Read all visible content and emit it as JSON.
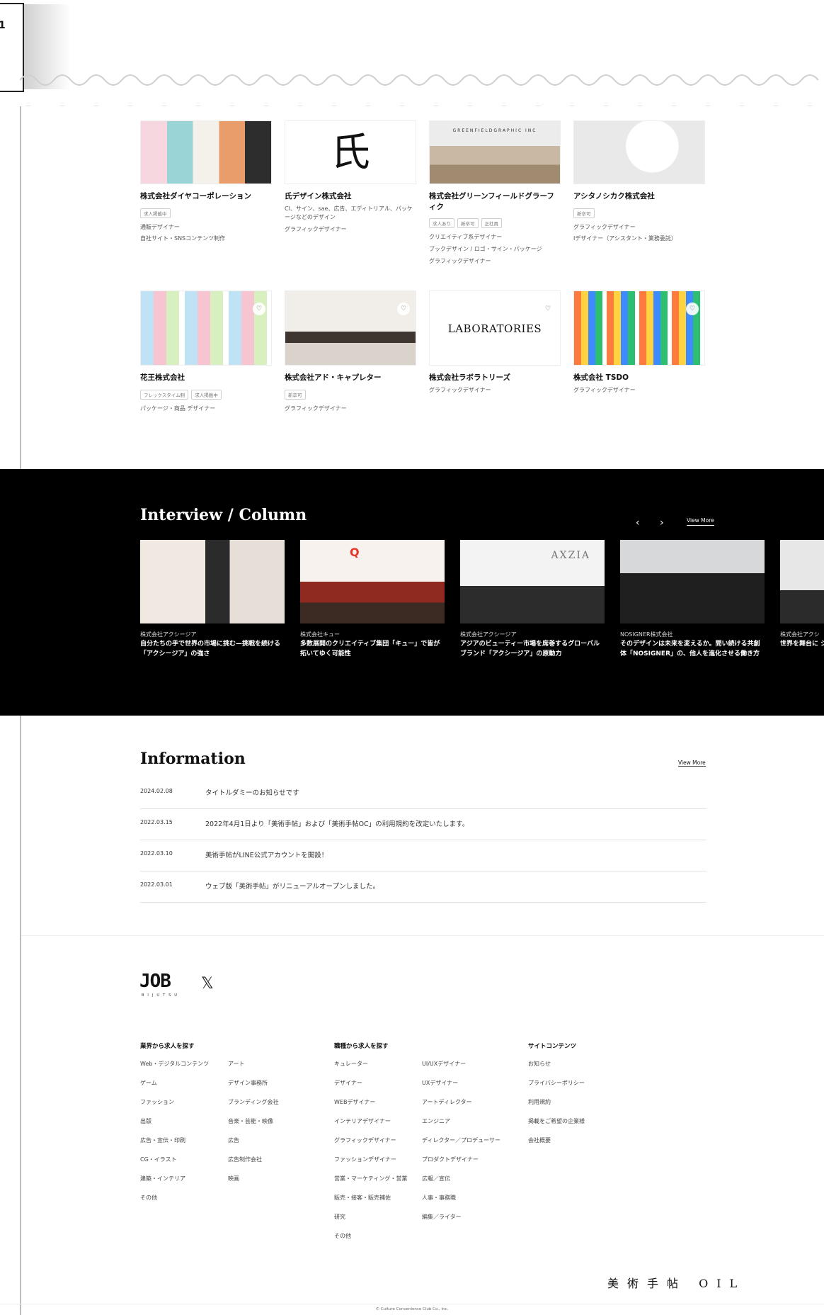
{
  "corner_label": "1",
  "companies": [
    {
      "name": "株式会社ダイヤコーポレーション",
      "tags": [
        "求人掲載中"
      ],
      "desc": [
        "通販デザイナー",
        "自社サイト・SNSコンテンツ制作"
      ],
      "thumb": "collage-people"
    },
    {
      "name": "氏デザイン株式会社",
      "tags": [],
      "desc": [
        "CI、サイン、sae、広告、エディトリアル、パッケージなどのデザイン",
        "グラフィックデザイナー"
      ],
      "thumb": "kanji",
      "kanji": "氏"
    },
    {
      "name": "株式会社グリーンフィールドグラーフィク",
      "tags": [
        "求人あり",
        "新卒可",
        "正社員"
      ],
      "desc": [
        "クリエイティブ系デザイナー",
        "ブックデザイン / ロゴ・サイン・パッケージ",
        "グラフィックデザイナー"
      ],
      "thumb": "office",
      "sign": "GREENFIELDGRAPHIC INC"
    },
    {
      "name": "アシタノシカク株式会社",
      "tags": [
        "新卒可"
      ],
      "desc": [
        "グラフィックデザイナー",
        "Iデザイナー（アシスタント・業務委託）"
      ],
      "thumb": "white"
    },
    {
      "name": "花王株式会社",
      "tags": [
        "フレックスタイム制",
        "求人掲載中"
      ],
      "desc": [
        "パッケージ・商品 デザイナー"
      ],
      "thumb": "products"
    },
    {
      "name": "株式会社アド・キャプレター",
      "tags": [
        "新卒可"
      ],
      "desc": [
        "グラフィックデザイナー"
      ],
      "thumb": "room"
    },
    {
      "name": "株式会社ラボラトリーズ",
      "tags": [],
      "desc": [
        "グラフィックデザイナー"
      ],
      "thumb": "laboratories",
      "logo": "LABORATORIES"
    },
    {
      "name": "株式会社 TSDO",
      "tags": [],
      "desc": [
        "グラフィックデザイナー"
      ],
      "thumb": "colorful"
    }
  ],
  "interview": {
    "title": "Interview / Column",
    "prev": "‹",
    "next": "›",
    "more": "View More",
    "cards": [
      {
        "company": "株式会社アクシージア",
        "text": "自分たちの手で世界の市場に挑む—挑戦を続ける「アクシージア」の強さ"
      },
      {
        "company": "株式会社キュー",
        "text": "多数展開のクリエイティブ集団「キュー」で皆が拓いてゆく可能性"
      },
      {
        "company": "株式会社アクシージア",
        "text": "アジアのビューティー市場を席巻するグローバルブランド「アクシージア」の原動力"
      },
      {
        "company": "NOSIGNER株式会社",
        "text": "そのデザインは未来を変えるか。問い続ける共創体「NOSIGNER」の、他人を進化させる働き方"
      },
      {
        "company": "株式会社アクシ",
        "text": "世界を舞台に シージアの強"
      }
    ],
    "axzia_sign": "AXZIA",
    "q_sign": "Q"
  },
  "information": {
    "title": "Information",
    "more": "View More",
    "items": [
      {
        "date": "2024.02.08",
        "text": "タイトルダミーのお知らせです"
      },
      {
        "date": "2022.03.15",
        "text": "2022年4月1日より「美術手帖」および「美術手帖OC」の利用規約を改定いたします。"
      },
      {
        "date": "2022.03.10",
        "text": "美術手帖がLINE公式アカウントを開設！"
      },
      {
        "date": "2022.03.01",
        "text": "ウェブ版「美術手帖」がリニューアルオープンしました。"
      }
    ]
  },
  "footer": {
    "logo": "JOB",
    "logo_sub": "BIJUTSU",
    "x_logo": "𝕏",
    "columns": [
      {
        "heading": "業界から求人を探す",
        "links": [
          [
            "Web・デジタルコンテンツ",
            "ゲーム",
            "ファッション",
            "出版",
            "広告・宣伝・印刷",
            "CG・イラスト",
            "建築・インテリア",
            "その他"
          ],
          [
            "アート",
            "デザイン事務所",
            "ブランディング会社",
            "音楽・芸能・映像",
            "広告",
            "広告制作会社",
            "映画"
          ]
        ]
      },
      {
        "heading": "職種から求人を探す",
        "links": [
          [
            "キュレーター",
            "デザイナー",
            "WEBデザイナー",
            "インテリアデザイナー",
            "グラフィックデザイナー",
            "ファッションデザイナー",
            "営業・マーケティング・営業",
            "販売・接客・販売補佐",
            "研究",
            "その他"
          ],
          [
            "UI/UXデザイナー",
            "UXデザイナー",
            "アートディレクター",
            "エンジニア",
            "ディレクター／プロデューサー",
            "プロダクトデザイナー",
            "広報／宣伝",
            "人事・事務職",
            "編集／ライター"
          ]
        ]
      },
      {
        "heading": "サイトコンテンツ",
        "links": [
          [
            "お知らせ",
            "プライバシーポリシー",
            "利用規約",
            "掲載をご希望の企業様",
            "会社概要"
          ]
        ]
      }
    ],
    "brands": "美術手帖 OIL",
    "copyright": "© Culture Convenience Club Co., Inc."
  }
}
